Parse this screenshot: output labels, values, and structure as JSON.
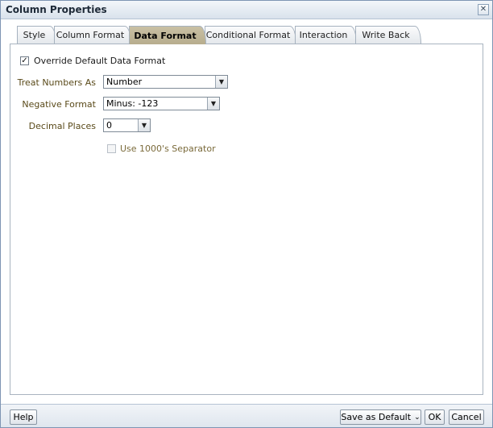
{
  "window": {
    "title": "Column Properties",
    "close_icon": "close-icon"
  },
  "tabs": [
    {
      "label": "Style",
      "active": false
    },
    {
      "label": "Column Format",
      "active": false
    },
    {
      "label": "Data Format",
      "active": true
    },
    {
      "label": "Conditional Format",
      "active": false
    },
    {
      "label": "Interaction",
      "active": false
    },
    {
      "label": "Write Back",
      "active": false
    }
  ],
  "form": {
    "override": {
      "label": "Override Default Data Format",
      "checked": true
    },
    "treat_numbers_as": {
      "label": "Treat Numbers As",
      "value": "Number"
    },
    "negative_format": {
      "label": "Negative Format",
      "value": "Minus: -123"
    },
    "decimal_places": {
      "label": "Decimal Places",
      "value": "0"
    },
    "separator": {
      "label": "Use 1000's Separator",
      "checked": false,
      "enabled": false
    }
  },
  "footer": {
    "help": "Help",
    "save_default": "Save as Default",
    "ok": "OK",
    "cancel": "Cancel"
  }
}
